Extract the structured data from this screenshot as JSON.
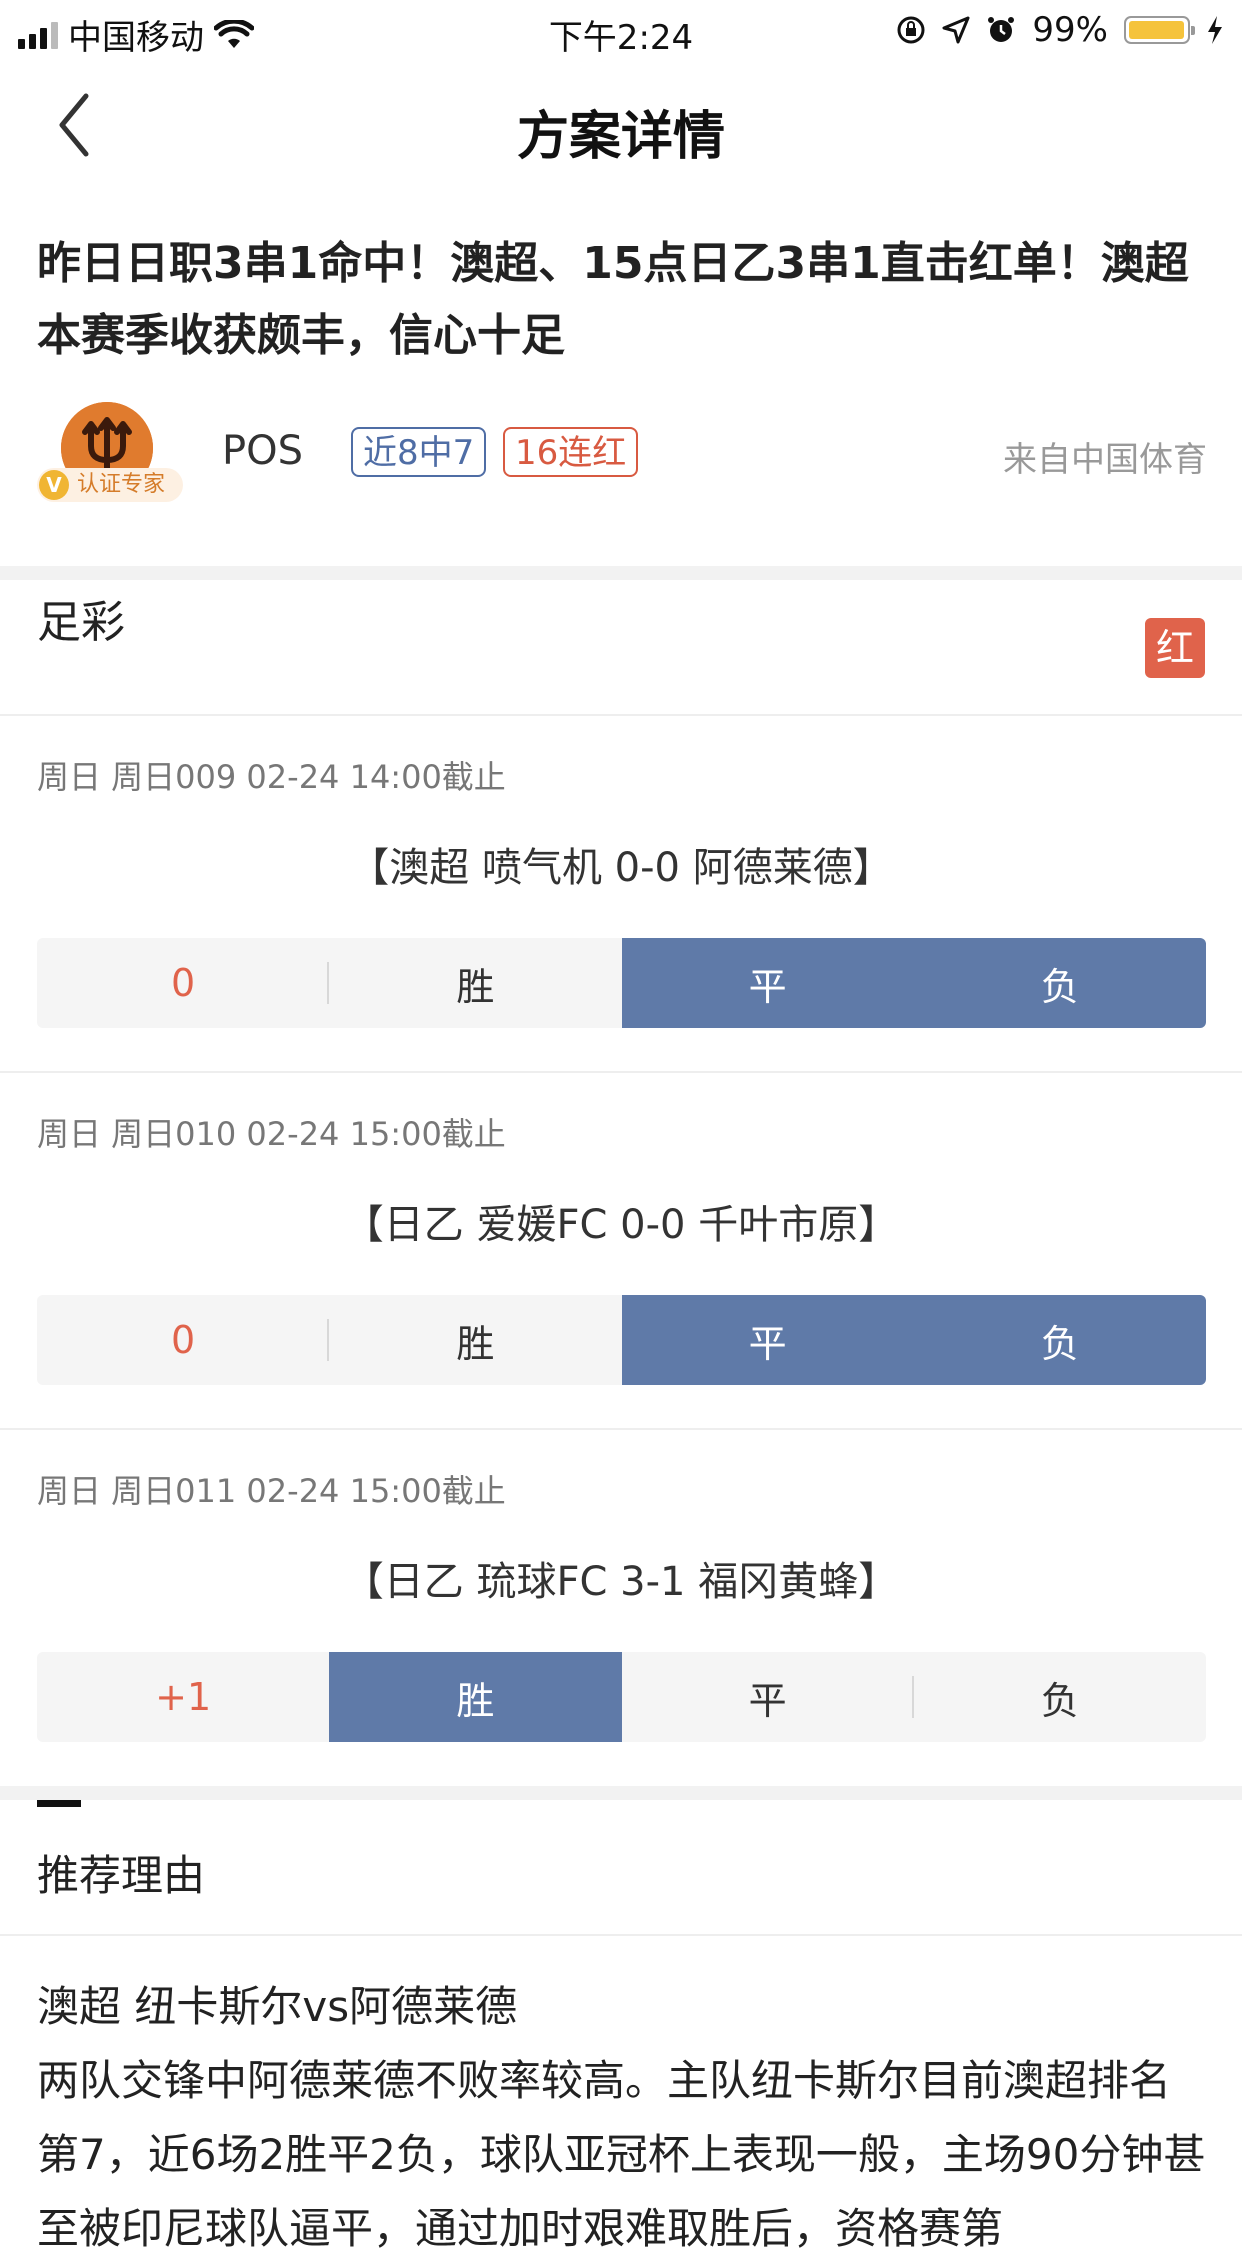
{
  "status_bar": {
    "carrier": "中国移动",
    "time": "下午2:24",
    "battery": "99%",
    "battery_level": 0.99
  },
  "nav": {
    "title": "方案详情"
  },
  "headline": "昨日日职3串1命中！澳超、15点日乙3串1直击红单！澳超本赛季收获颇丰，信心十足",
  "author": {
    "name": "POS",
    "verify_label": "认证专家",
    "verify_mark": "V",
    "tag_recent": "近8中7",
    "tag_streak": "16连红",
    "source": "来自中国体育"
  },
  "colors": {
    "selected": "#5f7aa8",
    "accent_red": "#e0634b",
    "tag_blue": "#4f6da5"
  },
  "lottery": {
    "title": "足彩",
    "result_badge": "红"
  },
  "matches": [
    {
      "meta": "周日 周日009 02-24 14:00截止",
      "title": "【澳超 喷气机 0-0 阿德莱德】",
      "handicap": "0",
      "options": [
        "胜",
        "平",
        "负"
      ],
      "selected": [
        "平",
        "负"
      ]
    },
    {
      "meta": "周日 周日010 02-24 15:00截止",
      "title": "【日乙 爱媛FC 0-0 千叶市原】",
      "handicap": "0",
      "options": [
        "胜",
        "平",
        "负"
      ],
      "selected": [
        "平",
        "负"
      ]
    },
    {
      "meta": "周日 周日011 02-24 15:00截止",
      "title": "【日乙 琉球FC 3-1 福冈黄蜂】",
      "handicap": "+1",
      "options": [
        "胜",
        "平",
        "负"
      ],
      "selected": [
        "胜"
      ]
    }
  ],
  "reason": {
    "title": "推荐理由",
    "match_line": "澳超 纽卡斯尔vs阿德莱德",
    "body": "两队交锋中阿德莱德不败率较高。主队纽卡斯尔目前澳超排名第7，近6场2胜平2负，球队亚冠杯上表现一般，主场90分钟甚至被印尼球队逼平，通过加时艰难取胜后，资格赛第"
  }
}
